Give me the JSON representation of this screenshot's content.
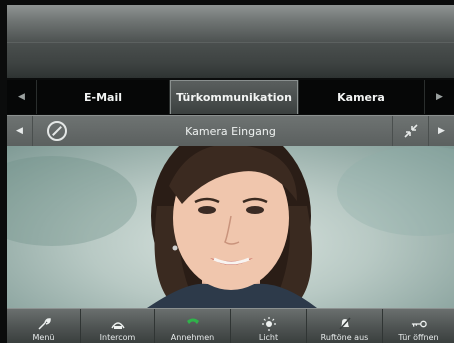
{
  "tabs": [
    {
      "label": "E-Mail"
    },
    {
      "label": "Türkommunikation"
    },
    {
      "label": "Kamera"
    }
  ],
  "camera": {
    "title": "Kamera Eingang"
  },
  "toolbar": {
    "items": [
      {
        "label": "Menü",
        "icon": "wrench-icon"
      },
      {
        "label": "Intercom",
        "icon": "intercom-icon"
      },
      {
        "label": "Annehmen",
        "icon": "phone-icon"
      },
      {
        "label": "Licht",
        "icon": "light-icon"
      },
      {
        "label": "Ruftöne aus",
        "icon": "bell-off-icon"
      },
      {
        "label": "Tür öffnen",
        "icon": "key-icon"
      }
    ]
  },
  "colors": {
    "accept_green": "#2fb34a",
    "tab_active_bg": "#4a4f4e",
    "bar_dark": "#060707"
  }
}
